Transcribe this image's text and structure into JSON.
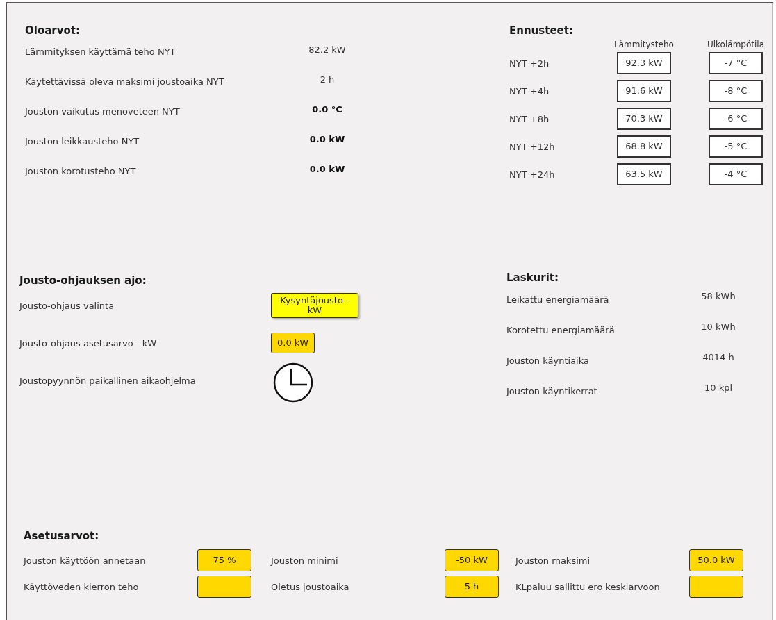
{
  "current_values": {
    "title": "Oloarvot:",
    "rows": [
      {
        "label": "Lämmityksen käyttämä teho NYT",
        "value": "82.2 kW",
        "bold": false
      },
      {
        "label": "Käytettävissä oleva maksimi joustoaika NYT",
        "value": "2 h",
        "bold": false
      },
      {
        "label": "Jouston vaikutus menoveteen NYT",
        "value": "0.0 °C",
        "bold": true
      },
      {
        "label": "Jouston leikkausteho NYT",
        "value": "0.0 kW",
        "bold": true
      },
      {
        "label": "Jouston korotusteho NYT",
        "value": "0.0 kW",
        "bold": true
      }
    ]
  },
  "forecasts": {
    "title": "Ennusteet:",
    "columns": [
      "Lämmitysteho",
      "Ulkolämpötila"
    ],
    "rows": [
      {
        "label": "NYT +2h",
        "power": "92.3 kW",
        "temperature": "-7 °C"
      },
      {
        "label": "NYT +4h",
        "power": "91.6 kW",
        "temperature": "-8 °C"
      },
      {
        "label": "NYT +8h",
        "power": "70.3 kW",
        "temperature": "-6 °C"
      },
      {
        "label": "NYT +12h",
        "power": "68.8 kW",
        "temperature": "-5 °C"
      },
      {
        "label": "NYT +24h",
        "power": "63.5 kW",
        "temperature": "-4 °C"
      }
    ]
  },
  "control_run": {
    "title": "Jousto-ohjauksen ajo:",
    "rows": [
      {
        "label": "Jousto-ohjaus valinta",
        "kind": "select",
        "value": "Kysyntäjousto - kW"
      },
      {
        "label": "Jousto-ohjaus asetusarvo - kW",
        "kind": "field",
        "value": "0.0 kW"
      },
      {
        "label": "Joustopyynnön paikallinen aikaohjelma",
        "kind": "schedule"
      }
    ]
  },
  "counters": {
    "title": "Laskurit:",
    "rows": [
      {
        "label": "Leikattu energiamäärä",
        "value": "58 kWh"
      },
      {
        "label": "Korotettu energiamäärä",
        "value": "10 kWh"
      },
      {
        "label": "Jouston käyntiaika",
        "value": "4014 h"
      },
      {
        "label": "Jouston käyntikerrat",
        "value": "10 kpl"
      }
    ]
  },
  "setpoints": {
    "title": "Asetusarvot:",
    "items": [
      {
        "label": "Jouston käyttöön annetaan",
        "value": "75 %"
      },
      {
        "label": "Jouston minimi",
        "value": "-50 kW"
      },
      {
        "label": "Jouston maksimi",
        "value": "50.0 kW"
      },
      {
        "label": "Käyttöveden kierron teho"
      },
      {
        "label": "Oletus joustoaika",
        "value": "5 h"
      },
      {
        "label": "KLpaluu sallittu ero keskiarvoon"
      }
    ]
  }
}
